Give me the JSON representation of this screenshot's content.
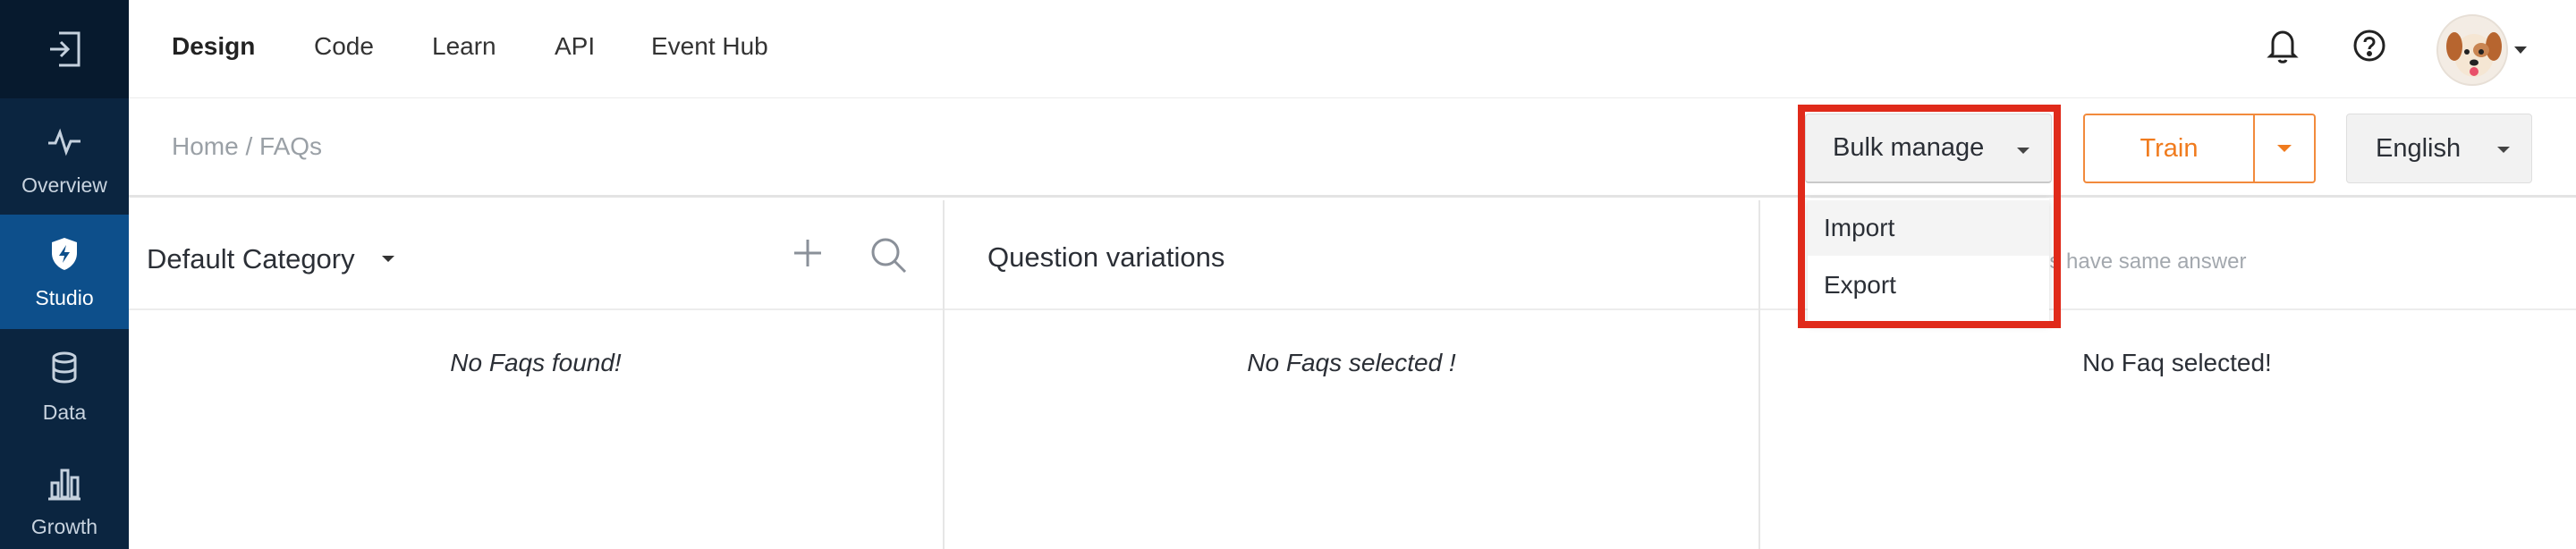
{
  "nav": {
    "tabs": [
      {
        "label": "Design",
        "active": true
      },
      {
        "label": "Code"
      },
      {
        "label": "Learn"
      },
      {
        "label": "API"
      },
      {
        "label": "Event Hub"
      }
    ],
    "icons": [
      "bell-icon",
      "help-icon",
      "avatar"
    ]
  },
  "sidebar": {
    "items": [
      {
        "label": "Overview",
        "icon": "pulse-icon"
      },
      {
        "label": "Studio",
        "icon": "shield-bolt-icon",
        "active": true
      },
      {
        "label": "Data",
        "icon": "database-icon"
      },
      {
        "label": "Growth",
        "icon": "bar-chart-icon"
      }
    ]
  },
  "breadcrumb": "Home / FAQs",
  "toolbar": {
    "bulk_label": "Bulk manage",
    "train_label": "Train",
    "language_label": "English"
  },
  "bulk_menu": {
    "items": [
      "Import",
      "Export"
    ]
  },
  "columns": {
    "category": {
      "title": "Default Category",
      "empty": "No Faqs found!"
    },
    "questions": {
      "title": "Question variations",
      "empty": "No Faqs selected !"
    },
    "answer": {
      "hint": "ns have same answer",
      "empty": "No Faq selected!"
    }
  },
  "colors": {
    "rail": "#0b2540",
    "rail_active": "#0d4f8b",
    "accent_orange": "#f07b1e",
    "highlight_red": "#e02a1a"
  }
}
